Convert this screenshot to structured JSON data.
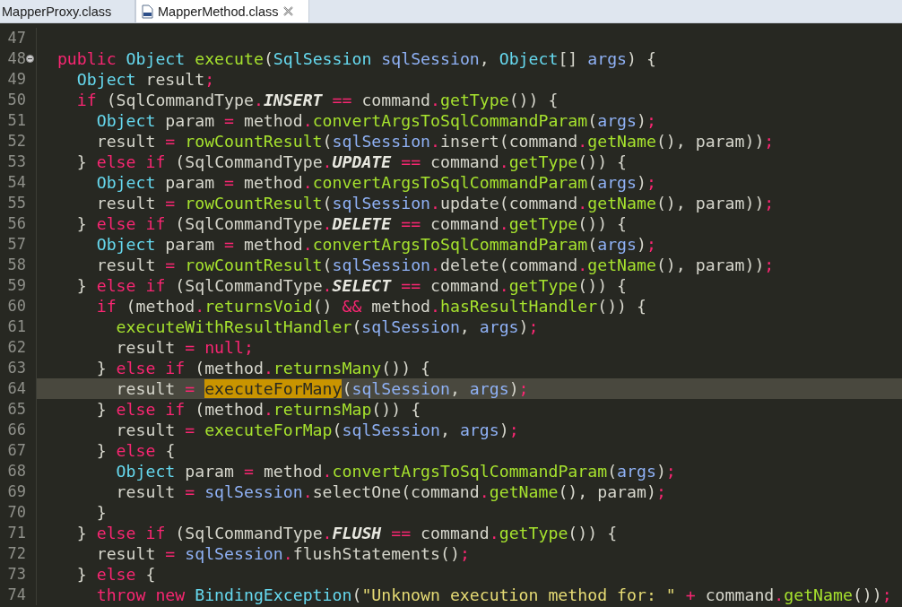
{
  "tabs": [
    {
      "label": "MapperProxy.class",
      "selected": false,
      "closable": false
    },
    {
      "label": "MapperMethod.class",
      "selected": true,
      "closable": true
    }
  ],
  "editor": {
    "lines": [
      {
        "number": "47",
        "highlighted": false,
        "fold": false
      },
      {
        "number": "48",
        "highlighted": false,
        "fold": true,
        "tokens": [
          {
            "text": "  public",
            "kind": "kw"
          },
          {
            "text": " Object",
            "kind": "ty"
          },
          {
            "text": " execute",
            "kind": "fn"
          },
          {
            "text": "(",
            "kind": "tx"
          },
          {
            "text": "SqlSession",
            "kind": "ty"
          },
          {
            "text": " sqlSession",
            "kind": "pa"
          },
          {
            "text": ", ",
            "kind": "tx"
          },
          {
            "text": "Object",
            "kind": "ty"
          },
          {
            "text": "[] ",
            "kind": "tx"
          },
          {
            "text": "args",
            "kind": "pa"
          },
          {
            "text": ") {",
            "kind": "tx"
          }
        ]
      },
      {
        "number": "49",
        "highlighted": false,
        "fold": false,
        "tokens": [
          {
            "text": "    Object",
            "kind": "ty"
          },
          {
            "text": " result",
            "kind": "tx"
          },
          {
            "text": ";",
            "kind": "op"
          }
        ]
      },
      {
        "number": "50",
        "highlighted": false,
        "fold": false,
        "tokens": [
          {
            "text": "    if",
            "kind": "kw"
          },
          {
            "text": " (SqlCommandType",
            "kind": "tx"
          },
          {
            "text": ".",
            "kind": "op"
          },
          {
            "text": "INSERT",
            "kind": "co"
          },
          {
            "text": " ==",
            "kind": "op"
          },
          {
            "text": " command",
            "kind": "tx"
          },
          {
            "text": ".",
            "kind": "op"
          },
          {
            "text": "getType",
            "kind": "fn"
          },
          {
            "text": "()) {",
            "kind": "tx"
          }
        ]
      },
      {
        "number": "51",
        "highlighted": false,
        "fold": false,
        "tokens": [
          {
            "text": "      Object",
            "kind": "ty"
          },
          {
            "text": " param ",
            "kind": "tx"
          },
          {
            "text": "=",
            "kind": "op"
          },
          {
            "text": " method",
            "kind": "tx"
          },
          {
            "text": ".",
            "kind": "op"
          },
          {
            "text": "convertArgsToSqlCommandParam",
            "kind": "fn"
          },
          {
            "text": "(",
            "kind": "tx"
          },
          {
            "text": "args",
            "kind": "pa"
          },
          {
            "text": ")",
            "kind": "tx"
          },
          {
            "text": ";",
            "kind": "op"
          }
        ]
      },
      {
        "number": "52",
        "highlighted": false,
        "fold": false,
        "tokens": [
          {
            "text": "      result ",
            "kind": "tx"
          },
          {
            "text": "=",
            "kind": "op"
          },
          {
            "text": " rowCountResult",
            "kind": "fn"
          },
          {
            "text": "(",
            "kind": "tx"
          },
          {
            "text": "sqlSession",
            "kind": "pa"
          },
          {
            "text": ".",
            "kind": "op"
          },
          {
            "text": "insert(command",
            "kind": "tx"
          },
          {
            "text": ".",
            "kind": "op"
          },
          {
            "text": "getName",
            "kind": "fn"
          },
          {
            "text": "(), param))",
            "kind": "tx"
          },
          {
            "text": ";",
            "kind": "op"
          }
        ]
      },
      {
        "number": "53",
        "highlighted": false,
        "fold": false,
        "tokens": [
          {
            "text": "    } ",
            "kind": "tx"
          },
          {
            "text": "else if",
            "kind": "kw"
          },
          {
            "text": " (SqlCommandType",
            "kind": "tx"
          },
          {
            "text": ".",
            "kind": "op"
          },
          {
            "text": "UPDATE",
            "kind": "co"
          },
          {
            "text": " ==",
            "kind": "op"
          },
          {
            "text": " command",
            "kind": "tx"
          },
          {
            "text": ".",
            "kind": "op"
          },
          {
            "text": "getType",
            "kind": "fn"
          },
          {
            "text": "()) {",
            "kind": "tx"
          }
        ]
      },
      {
        "number": "54",
        "highlighted": false,
        "fold": false,
        "tokens": [
          {
            "text": "      Object",
            "kind": "ty"
          },
          {
            "text": " param ",
            "kind": "tx"
          },
          {
            "text": "=",
            "kind": "op"
          },
          {
            "text": " method",
            "kind": "tx"
          },
          {
            "text": ".",
            "kind": "op"
          },
          {
            "text": "convertArgsToSqlCommandParam",
            "kind": "fn"
          },
          {
            "text": "(",
            "kind": "tx"
          },
          {
            "text": "args",
            "kind": "pa"
          },
          {
            "text": ")",
            "kind": "tx"
          },
          {
            "text": ";",
            "kind": "op"
          }
        ]
      },
      {
        "number": "55",
        "highlighted": false,
        "fold": false,
        "tokens": [
          {
            "text": "      result ",
            "kind": "tx"
          },
          {
            "text": "=",
            "kind": "op"
          },
          {
            "text": " rowCountResult",
            "kind": "fn"
          },
          {
            "text": "(",
            "kind": "tx"
          },
          {
            "text": "sqlSession",
            "kind": "pa"
          },
          {
            "text": ".",
            "kind": "op"
          },
          {
            "text": "update(command",
            "kind": "tx"
          },
          {
            "text": ".",
            "kind": "op"
          },
          {
            "text": "getName",
            "kind": "fn"
          },
          {
            "text": "(), param))",
            "kind": "tx"
          },
          {
            "text": ";",
            "kind": "op"
          }
        ]
      },
      {
        "number": "56",
        "highlighted": false,
        "fold": false,
        "tokens": [
          {
            "text": "    } ",
            "kind": "tx"
          },
          {
            "text": "else if",
            "kind": "kw"
          },
          {
            "text": " (SqlCommandType",
            "kind": "tx"
          },
          {
            "text": ".",
            "kind": "op"
          },
          {
            "text": "DELETE",
            "kind": "co"
          },
          {
            "text": " ==",
            "kind": "op"
          },
          {
            "text": " command",
            "kind": "tx"
          },
          {
            "text": ".",
            "kind": "op"
          },
          {
            "text": "getType",
            "kind": "fn"
          },
          {
            "text": "()) {",
            "kind": "tx"
          }
        ]
      },
      {
        "number": "57",
        "highlighted": false,
        "fold": false,
        "tokens": [
          {
            "text": "      Object",
            "kind": "ty"
          },
          {
            "text": " param ",
            "kind": "tx"
          },
          {
            "text": "=",
            "kind": "op"
          },
          {
            "text": " method",
            "kind": "tx"
          },
          {
            "text": ".",
            "kind": "op"
          },
          {
            "text": "convertArgsToSqlCommandParam",
            "kind": "fn"
          },
          {
            "text": "(",
            "kind": "tx"
          },
          {
            "text": "args",
            "kind": "pa"
          },
          {
            "text": ")",
            "kind": "tx"
          },
          {
            "text": ";",
            "kind": "op"
          }
        ]
      },
      {
        "number": "58",
        "highlighted": false,
        "fold": false,
        "tokens": [
          {
            "text": "      result ",
            "kind": "tx"
          },
          {
            "text": "=",
            "kind": "op"
          },
          {
            "text": " rowCountResult",
            "kind": "fn"
          },
          {
            "text": "(",
            "kind": "tx"
          },
          {
            "text": "sqlSession",
            "kind": "pa"
          },
          {
            "text": ".",
            "kind": "op"
          },
          {
            "text": "delete(command",
            "kind": "tx"
          },
          {
            "text": ".",
            "kind": "op"
          },
          {
            "text": "getName",
            "kind": "fn"
          },
          {
            "text": "(), param))",
            "kind": "tx"
          },
          {
            "text": ";",
            "kind": "op"
          }
        ]
      },
      {
        "number": "59",
        "highlighted": false,
        "fold": false,
        "tokens": [
          {
            "text": "    } ",
            "kind": "tx"
          },
          {
            "text": "else if",
            "kind": "kw"
          },
          {
            "text": " (SqlCommandType",
            "kind": "tx"
          },
          {
            "text": ".",
            "kind": "op"
          },
          {
            "text": "SELECT",
            "kind": "co"
          },
          {
            "text": " ==",
            "kind": "op"
          },
          {
            "text": " command",
            "kind": "tx"
          },
          {
            "text": ".",
            "kind": "op"
          },
          {
            "text": "getType",
            "kind": "fn"
          },
          {
            "text": "()) {",
            "kind": "tx"
          }
        ]
      },
      {
        "number": "60",
        "highlighted": false,
        "fold": false,
        "tokens": [
          {
            "text": "      if",
            "kind": "kw"
          },
          {
            "text": " (method",
            "kind": "tx"
          },
          {
            "text": ".",
            "kind": "op"
          },
          {
            "text": "returnsVoid",
            "kind": "fn"
          },
          {
            "text": "() ",
            "kind": "tx"
          },
          {
            "text": "&&",
            "kind": "op"
          },
          {
            "text": " method",
            "kind": "tx"
          },
          {
            "text": ".",
            "kind": "op"
          },
          {
            "text": "hasResultHandler",
            "kind": "fn"
          },
          {
            "text": "()) {",
            "kind": "tx"
          }
        ]
      },
      {
        "number": "61",
        "highlighted": false,
        "fold": false,
        "tokens": [
          {
            "text": "        executeWithResultHandler",
            "kind": "fn"
          },
          {
            "text": "(",
            "kind": "tx"
          },
          {
            "text": "sqlSession",
            "kind": "pa"
          },
          {
            "text": ", ",
            "kind": "tx"
          },
          {
            "text": "args",
            "kind": "pa"
          },
          {
            "text": ")",
            "kind": "tx"
          },
          {
            "text": ";",
            "kind": "op"
          }
        ]
      },
      {
        "number": "62",
        "highlighted": false,
        "fold": false,
        "tokens": [
          {
            "text": "        result ",
            "kind": "tx"
          },
          {
            "text": "=",
            "kind": "op"
          },
          {
            "text": " null",
            "kind": "kw"
          },
          {
            "text": ";",
            "kind": "op"
          }
        ]
      },
      {
        "number": "63",
        "highlighted": false,
        "fold": false,
        "tokens": [
          {
            "text": "      } ",
            "kind": "tx"
          },
          {
            "text": "else if",
            "kind": "kw"
          },
          {
            "text": " (method",
            "kind": "tx"
          },
          {
            "text": ".",
            "kind": "op"
          },
          {
            "text": "returnsMany",
            "kind": "fn"
          },
          {
            "text": "()) {",
            "kind": "tx"
          }
        ]
      },
      {
        "number": "64",
        "highlighted": true,
        "fold": false,
        "tokens": [
          {
            "text": "        result ",
            "kind": "tx"
          },
          {
            "text": "= ",
            "kind": "op"
          },
          {
            "text": "executeForMany",
            "kind": "oc"
          },
          {
            "text": "(",
            "kind": "tx"
          },
          {
            "text": "sqlSession",
            "kind": "pa"
          },
          {
            "text": ", ",
            "kind": "tx"
          },
          {
            "text": "args",
            "kind": "pa"
          },
          {
            "text": ")",
            "kind": "tx"
          },
          {
            "text": ";",
            "kind": "op"
          }
        ]
      },
      {
        "number": "65",
        "highlighted": false,
        "fold": false,
        "tokens": [
          {
            "text": "      } ",
            "kind": "tx"
          },
          {
            "text": "else if",
            "kind": "kw"
          },
          {
            "text": " (method",
            "kind": "tx"
          },
          {
            "text": ".",
            "kind": "op"
          },
          {
            "text": "returnsMap",
            "kind": "fn"
          },
          {
            "text": "()) {",
            "kind": "tx"
          }
        ]
      },
      {
        "number": "66",
        "highlighted": false,
        "fold": false,
        "tokens": [
          {
            "text": "        result ",
            "kind": "tx"
          },
          {
            "text": "= ",
            "kind": "op"
          },
          {
            "text": "executeForMap",
            "kind": "fn"
          },
          {
            "text": "(",
            "kind": "tx"
          },
          {
            "text": "sqlSession",
            "kind": "pa"
          },
          {
            "text": ", ",
            "kind": "tx"
          },
          {
            "text": "args",
            "kind": "pa"
          },
          {
            "text": ")",
            "kind": "tx"
          },
          {
            "text": ";",
            "kind": "op"
          }
        ]
      },
      {
        "number": "67",
        "highlighted": false,
        "fold": false,
        "tokens": [
          {
            "text": "      } ",
            "kind": "tx"
          },
          {
            "text": "else",
            "kind": "kw"
          },
          {
            "text": " {",
            "kind": "tx"
          }
        ]
      },
      {
        "number": "68",
        "highlighted": false,
        "fold": false,
        "tokens": [
          {
            "text": "        Object",
            "kind": "ty"
          },
          {
            "text": " param ",
            "kind": "tx"
          },
          {
            "text": "=",
            "kind": "op"
          },
          {
            "text": " method",
            "kind": "tx"
          },
          {
            "text": ".",
            "kind": "op"
          },
          {
            "text": "convertArgsToSqlCommandParam",
            "kind": "fn"
          },
          {
            "text": "(",
            "kind": "tx"
          },
          {
            "text": "args",
            "kind": "pa"
          },
          {
            "text": ")",
            "kind": "tx"
          },
          {
            "text": ";",
            "kind": "op"
          }
        ]
      },
      {
        "number": "69",
        "highlighted": false,
        "fold": false,
        "tokens": [
          {
            "text": "        result ",
            "kind": "tx"
          },
          {
            "text": "= ",
            "kind": "op"
          },
          {
            "text": "sqlSession",
            "kind": "pa"
          },
          {
            "text": ".",
            "kind": "op"
          },
          {
            "text": "selectOne(command",
            "kind": "tx"
          },
          {
            "text": ".",
            "kind": "op"
          },
          {
            "text": "getName",
            "kind": "fn"
          },
          {
            "text": "(), param)",
            "kind": "tx"
          },
          {
            "text": ";",
            "kind": "op"
          }
        ]
      },
      {
        "number": "70",
        "highlighted": false,
        "fold": false,
        "tokens": [
          {
            "text": "      }",
            "kind": "tx"
          }
        ]
      },
      {
        "number": "71",
        "highlighted": false,
        "fold": false,
        "tokens": [
          {
            "text": "    } ",
            "kind": "tx"
          },
          {
            "text": "else if",
            "kind": "kw"
          },
          {
            "text": " (SqlCommandType",
            "kind": "tx"
          },
          {
            "text": ".",
            "kind": "op"
          },
          {
            "text": "FLUSH",
            "kind": "co"
          },
          {
            "text": " ==",
            "kind": "op"
          },
          {
            "text": " command",
            "kind": "tx"
          },
          {
            "text": ".",
            "kind": "op"
          },
          {
            "text": "getType",
            "kind": "fn"
          },
          {
            "text": "()) {",
            "kind": "tx"
          }
        ]
      },
      {
        "number": "72",
        "highlighted": false,
        "fold": false,
        "tokens": [
          {
            "text": "      result ",
            "kind": "tx"
          },
          {
            "text": "= ",
            "kind": "op"
          },
          {
            "text": "sqlSession",
            "kind": "pa"
          },
          {
            "text": ".",
            "kind": "op"
          },
          {
            "text": "flushStatements()",
            "kind": "tx"
          },
          {
            "text": ";",
            "kind": "op"
          }
        ]
      },
      {
        "number": "73",
        "highlighted": false,
        "fold": false,
        "tokens": [
          {
            "text": "    } ",
            "kind": "tx"
          },
          {
            "text": "else",
            "kind": "kw"
          },
          {
            "text": " {",
            "kind": "tx"
          }
        ]
      },
      {
        "number": "74",
        "highlighted": false,
        "fold": false,
        "tokens": [
          {
            "text": "      throw new",
            "kind": "kw"
          },
          {
            "text": " BindingException",
            "kind": "ty"
          },
          {
            "text": "(",
            "kind": "tx"
          },
          {
            "text": "\"Unknown execution method for: \"",
            "kind": "st"
          },
          {
            "text": " +",
            "kind": "op"
          },
          {
            "text": " command",
            "kind": "tx"
          },
          {
            "text": ".",
            "kind": "op"
          },
          {
            "text": "getName",
            "kind": "fn"
          },
          {
            "text": "())",
            "kind": "tx"
          },
          {
            "text": ";",
            "kind": "op"
          }
        ]
      }
    ]
  }
}
